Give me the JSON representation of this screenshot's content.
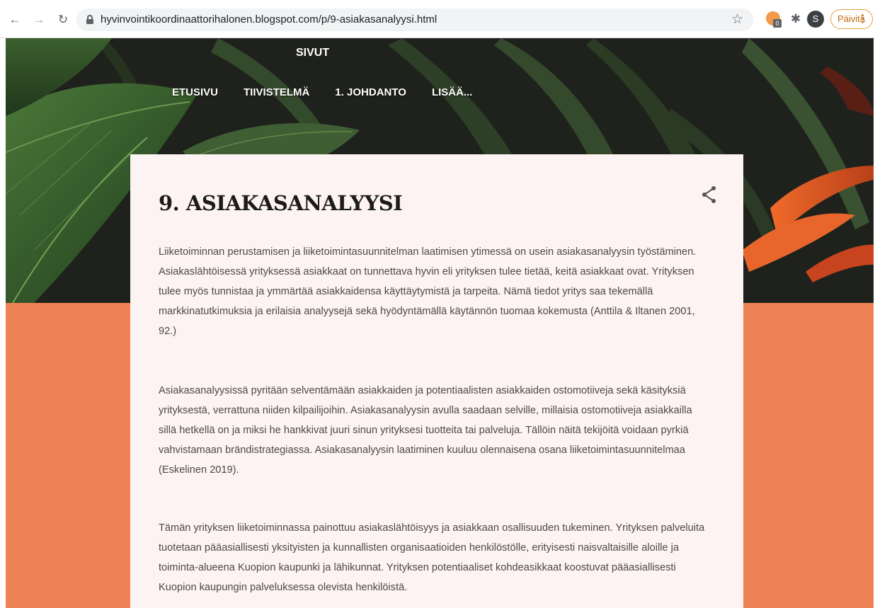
{
  "browser": {
    "url": "hyvinvointikoordinaattorihalonen.blogspot.com/p/9-asiakasanalyysi.html",
    "extension_badge": "0",
    "profile_initial": "S",
    "update_label": "Päivitä",
    "icons": [
      "back-icon",
      "forward-icon",
      "reload-icon",
      "lock-icon",
      "star-icon",
      "extension-icon",
      "puzzle-icon",
      "menu-icon"
    ]
  },
  "header": {
    "pages_title": "SIVUT",
    "nav": [
      {
        "label": "ETUSIVU"
      },
      {
        "label": "TIIVISTELMÄ"
      },
      {
        "label": "1. JOHDANTO"
      },
      {
        "label": "LISÄÄ..."
      }
    ]
  },
  "post": {
    "title": "9. ASIAKASANALYYSI",
    "paragraphs": [
      "Liiketoiminnan perustamisen ja liiketoimintasuunnitelman laatimisen ytimessä on usein asiakasanalyysin työstäminen. Asiakaslähtöisessä yrityksessä asiakkaat on tunnettava hyvin eli yrityksen tulee tietää, keitä asiakkaat ovat.  Yrityksen tulee myös tunnistaa ja ymmärtää asiakkaidensa käyttäytymistä ja tarpeita. Nämä tiedot yritys saa tekemällä markkinatutkimuksia ja erilaisia analyysejä sekä hyödyntämällä käytännön tuomaa kokemusta (Anttila & Iltanen 2001, 92.)",
      "Asiakasanalyysissä pyritään selventämään asiakkaiden ja potentiaalisten asiakkaiden ostomotiiveja sekä käsityksiä yrityksestä, verrattuna niiden kilpailijoihin. Asiakasanalyysin avulla saadaan selville, millaisia ostomotiiveja asiakkailla sillä hetkellä on ja miksi he hankkivat juuri sinun yrityksesi tuotteita tai palveluja. Tällöin näitä tekijöitä voidaan pyrkiä vahvistamaan brändistrategiassa. Asiakasanalyysin laatiminen kuuluu olennaisena osana liiketoimintasuunnitelmaa (Eskelinen 2019).",
      "Tämän yrityksen liiketoiminnassa painottuu asiakaslähtöisyys ja asiakkaan osallisuuden tukeminen. Yrityksen palveluita tuotetaan pääasiallisesti yksityisten ja kunnallisten organisaatioiden henkilöstölle, erityisesti naisvaltaisille aloille ja toiminta-alueena Kuopion kaupunki ja lähikunnat. Yrityksen potentiaaliset kohdeasikkaat koostuvat pääasiallisesti Kuopion kaupungin palveluksessa olevista henkilöistä."
    ]
  },
  "colors": {
    "accent": "#f08356",
    "card_background": "#fdf3f2",
    "hero_dark": "#1c1e19"
  }
}
